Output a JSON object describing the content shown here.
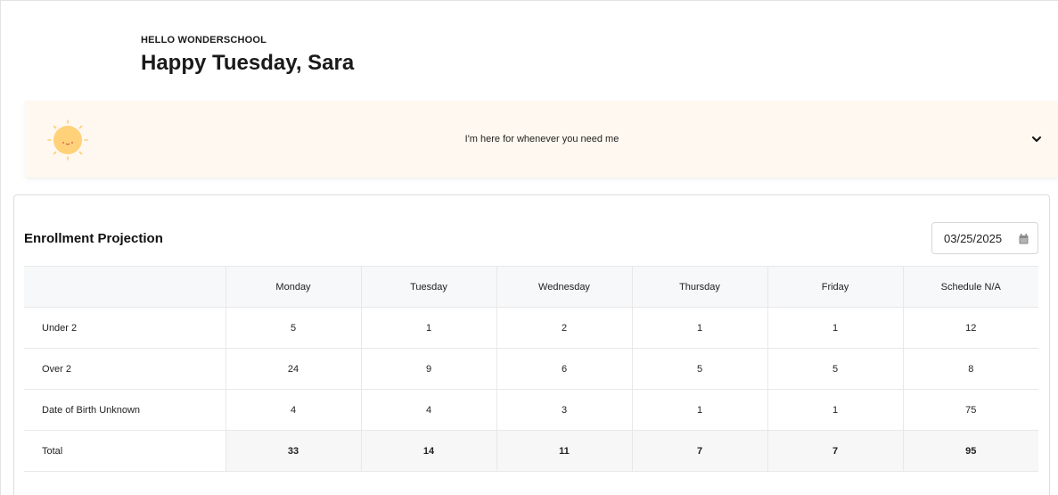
{
  "greeting": {
    "eyebrow": "HELLO WONDERSCHOOL",
    "headline": "Happy Tuesday, Sara"
  },
  "assistant": {
    "icon": "sun-icon",
    "message": "I'm here for whenever you need me",
    "expand_icon": "chevron-down-icon"
  },
  "enrollment": {
    "title": "Enrollment Projection",
    "date_value": "03/25/2025",
    "date_icon": "calendar-icon",
    "columns": [
      "",
      "Monday",
      "Tuesday",
      "Wednesday",
      "Thursday",
      "Friday",
      "Schedule N/A"
    ],
    "rows": [
      {
        "label": "Under 2",
        "values": [
          "5",
          "1",
          "2",
          "1",
          "1",
          "12"
        ]
      },
      {
        "label": "Over 2",
        "values": [
          "24",
          "9",
          "6",
          "5",
          "5",
          "8"
        ]
      },
      {
        "label": "Date of Birth Unknown",
        "values": [
          "4",
          "4",
          "3",
          "1",
          "1",
          "75"
        ]
      },
      {
        "label": "Total",
        "values": [
          "33",
          "14",
          "11",
          "7",
          "7",
          "95"
        ]
      }
    ]
  },
  "colors": {
    "banner_bg": "#fff8f0",
    "sun_fill": "#ffd27a",
    "header_row_bg": "#f7f8fa"
  }
}
